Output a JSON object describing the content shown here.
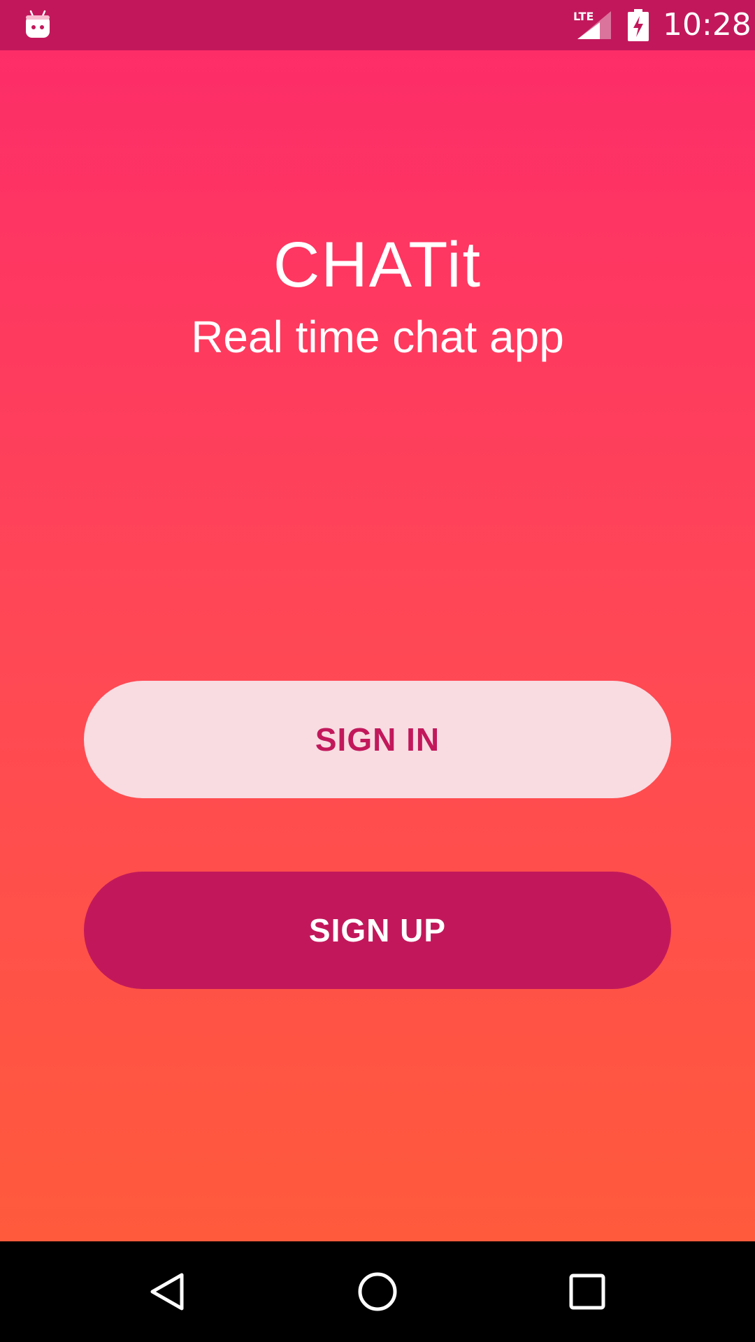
{
  "status_bar": {
    "time": "10:28",
    "network_label": "LTE",
    "icons": [
      "android-notification-icon",
      "lte-signal-icon",
      "battery-charging-icon"
    ]
  },
  "app": {
    "title": "CHATit",
    "subtitle": "Real time chat app"
  },
  "buttons": {
    "sign_in_label": "SIGN IN",
    "sign_up_label": "SIGN UP"
  },
  "nav_bar": {
    "icons": [
      "back-icon",
      "home-icon",
      "recents-icon"
    ]
  },
  "colors": {
    "status_bar": "#c2185b",
    "gradient_top": "#fd2d68",
    "gradient_bottom": "#ff5a3c",
    "sign_in_bg": "#f8dce2",
    "sign_in_text": "#c2185b",
    "sign_up_bg": "#c2185b",
    "sign_up_text": "#ffffff"
  }
}
